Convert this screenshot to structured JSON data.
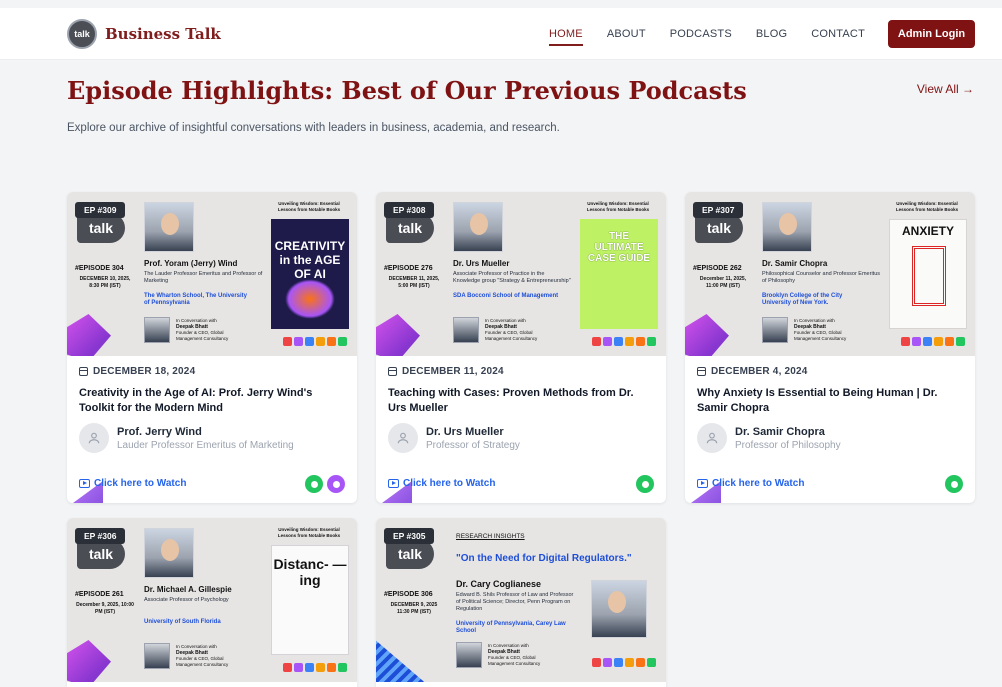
{
  "nav": {
    "brand_logo": "talk",
    "brand": "Business Talk",
    "links": [
      "HOME",
      "ABOUT",
      "PODCASTS",
      "BLOG",
      "CONTACT"
    ],
    "admin": "Admin Login"
  },
  "header": {
    "title": "Episode Highlights: Best of Our Previous Podcasts",
    "view_all": "View All →",
    "intro": "Explore our archive of insightful conversations with leaders in business, academia, and research."
  },
  "cards": [
    {
      "badge": "EP #309",
      "logo": "talk",
      "thumb_episode": "#EPISODE 304",
      "thumb_date": "DECEMBER 10, 2025, 8:30 PM (IST)",
      "thumb_name": "Prof. Yoram (Jerry) Wind",
      "thumb_role": "The Lauder Professor Emeritus and Professor of Marketing",
      "thumb_inst": "The Wharton School, The University of Pennsylvania",
      "conv_label": "In Conversation with",
      "conv_host": "Deepak Bhatt",
      "conv_host_role": "Founder & CEO, Global Management Consultancy",
      "book_tag": "Unveiling Wisdom: Essential Lessons from Notable Books",
      "book_title": "CREATIVITY in the AGE OF AI",
      "book_color": "#1e1b4b",
      "date": "DECEMBER 18, 2024",
      "title": "Creativity in the Age of AI: Prof. Jerry Wind's Toolkit for the Modern Mind",
      "guest": "Prof. Jerry Wind",
      "guest_role": "Lauder Professor Emeritus of Marketing",
      "watch": "Click here to Watch",
      "platforms": [
        "#22c55e",
        "#a855f7"
      ]
    },
    {
      "badge": "EP #308",
      "logo": "talk",
      "thumb_episode": "#EPISODE 276",
      "thumb_date": "DECEMBER 11, 2025, 5:00 PM (IST)",
      "thumb_name": "Dr. Urs Mueller",
      "thumb_role": "Associate Professor of Practice in the Knowledge group \"Strategy & Entrepreneurship\"",
      "thumb_inst": "SDA Bocconi School of Management",
      "conv_label": "In Conversation with",
      "conv_host": "Deepak Bhatt",
      "conv_host_role": "Founder & CEO, Global Management Consultancy",
      "book_tag": "Unveiling Wisdom: Essential Lessons from Notable Books",
      "book_title": "THE ULTIMATE CASE GUIDE",
      "book_color": "#bef264",
      "date": "DECEMBER 11, 2024",
      "title": "Teaching with Cases: Proven Methods from Dr. Urs Mueller",
      "guest": "Dr. Urs Mueller",
      "guest_role": "Professor of Strategy",
      "watch": "Click here to Watch",
      "platforms": [
        "#22c55e"
      ]
    },
    {
      "badge": "EP #307",
      "logo": "talk",
      "thumb_episode": "#EPISODE 262",
      "thumb_date": "December 11, 2025, 11:00 PM (IST)",
      "thumb_name": "Dr. Samir Chopra",
      "thumb_role": "Philosophical Counselor and Professor Emeritus of Philosophy",
      "thumb_inst": "Brooklyn College of the City University of New York.",
      "conv_label": "In Conversation with",
      "conv_host": "Deepak Bhatt",
      "conv_host_role": "Founder & CEO, Global Management Consultancy",
      "book_tag": "Unveiling Wisdom: Essential Lessons from Notable Books",
      "book_title": "ANXIETY",
      "book_color": "#fafaf9",
      "date": "DECEMBER 4, 2024",
      "title": "Why Anxiety Is Essential to Being Human | Dr. Samir Chopra",
      "guest": "Dr. Samir Chopra",
      "guest_role": "Professor of Philosophy",
      "watch": "Click here to Watch",
      "platforms": [
        "#22c55e"
      ]
    },
    {
      "badge": "EP #306",
      "logo": "talk",
      "thumb_episode": "#EPISODE 261",
      "thumb_date": "December 9, 2025, 10:00 PM (IST)",
      "thumb_name": "Dr. Michael A. Gillespie",
      "thumb_role": "Associate Professor of Psychology",
      "thumb_inst": "University of South Florida",
      "conv_label": "In Conversation with",
      "conv_host": "Deepak Bhatt",
      "conv_host_role": "Founder & CEO, Global Management Consultancy",
      "book_tag": "Unveiling Wisdom: Essential Lessons from Notable Books",
      "book_title": "Distanc- —ing",
      "book_color": "#fafafa"
    },
    {
      "badge": "EP #305",
      "logo": "talk",
      "thumb_episode": "#EPISODE 306",
      "thumb_date": "DECEMBER 9, 2025 11:30 PM (IST)",
      "research": "RESEARCH INSIGHTS",
      "quote": "\"On the Need for Digital Regulators.\"",
      "thumb_name": "Dr. Cary Coglianese",
      "thumb_role": "Edward B. Shils Professor of Law and Professor of Political Science; Director, Penn Program on Regulation",
      "thumb_inst": "University of Pennsylvania, Carey Law School",
      "conv_label": "In Conversation with",
      "conv_host": "Deepak Bhatt",
      "conv_host_role": "Founder & CEO, Global Management Consultancy"
    }
  ]
}
